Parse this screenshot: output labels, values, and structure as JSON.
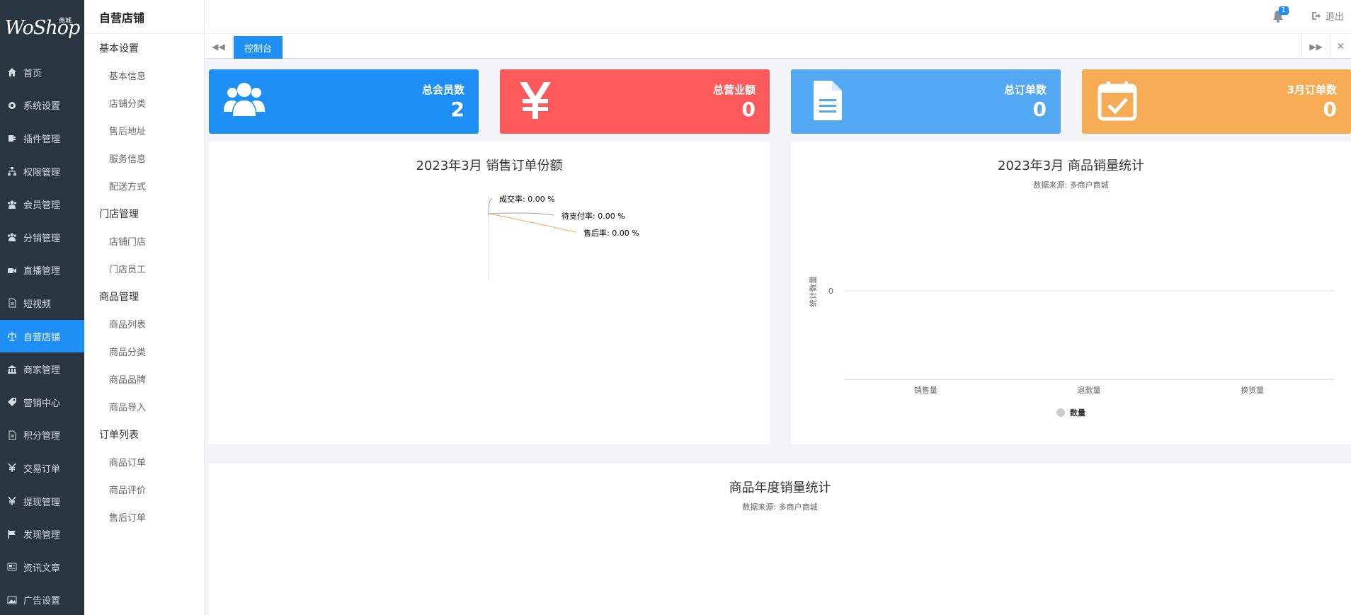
{
  "brand": {
    "logo_text": "WoShop",
    "logo_small": "商城"
  },
  "nav": {
    "items": [
      {
        "label": "首页",
        "icon": "home-icon"
      },
      {
        "label": "系统设置",
        "icon": "gear-icon"
      },
      {
        "label": "插件管理",
        "icon": "plugin-icon"
      },
      {
        "label": "权限管理",
        "icon": "sitemap-icon"
      },
      {
        "label": "会员管理",
        "icon": "users-icon"
      },
      {
        "label": "分销管理",
        "icon": "users-icon"
      },
      {
        "label": "直播管理",
        "icon": "video-icon"
      },
      {
        "label": "短视频",
        "icon": "file-icon"
      },
      {
        "label": "自营店铺",
        "icon": "scale-icon",
        "active": true
      },
      {
        "label": "商家管理",
        "icon": "bank-icon"
      },
      {
        "label": "营销中心",
        "icon": "tag-icon"
      },
      {
        "label": "积分管理",
        "icon": "file-icon"
      },
      {
        "label": "交易订单",
        "icon": "yen-icon"
      },
      {
        "label": "提现管理",
        "icon": "yen-icon"
      },
      {
        "label": "发现管理",
        "icon": "flag-icon"
      },
      {
        "label": "资讯文章",
        "icon": "news-icon"
      },
      {
        "label": "广告设置",
        "icon": "image-icon"
      }
    ],
    "accent": "#1e8ff5",
    "background": "#2a3542"
  },
  "submenu": {
    "title": "自营店铺",
    "groups": [
      {
        "label": "基本设置",
        "links": [
          "基本信息",
          "店铺分类",
          "售后地址",
          "服务信息",
          "配送方式"
        ]
      },
      {
        "label": "门店管理",
        "links": [
          "店铺门店",
          "门店员工"
        ]
      },
      {
        "label": "商品管理",
        "links": [
          "商品列表",
          "商品分类",
          "商品品牌",
          "商品导入"
        ]
      },
      {
        "label": "订单列表",
        "links": [
          "商品订单",
          "商品评价",
          "售后订单"
        ]
      }
    ]
  },
  "topbar": {
    "badge": "1",
    "logout": "退出"
  },
  "tabs": {
    "active": "控制台"
  },
  "cards": [
    {
      "label": "总会员数",
      "value": "2",
      "icon": "users-icon",
      "color": "#1e8ff5"
    },
    {
      "label": "总营业额",
      "value": "0",
      "icon": "yen-icon",
      "color": "#fe5a5b"
    },
    {
      "label": "总订单数",
      "value": "0",
      "icon": "document-icon",
      "color": "#53a8f4"
    },
    {
      "label": "3月订单数",
      "value": "0",
      "icon": "calendar-check-icon",
      "color": "#f6ac55"
    }
  ],
  "panels": {
    "pie_title": "2023年3月 销售订单份额",
    "bar_title": "2023年3月 商品销量统计",
    "bar_source": "数据来源: 多商户商城",
    "year_title": "商品年度销量统计",
    "year_source": "数据来源: 多商户商城"
  },
  "chart_data": [
    {
      "type": "pie",
      "title": "2023年3月 销售订单份额",
      "slices": [
        {
          "label": "成交率",
          "value": 0.0,
          "display": "成交率: 0.00 %"
        },
        {
          "label": "待支付率",
          "value": 0.0,
          "display": "待支付率: 0.00 %"
        },
        {
          "label": "售后率",
          "value": 0.0,
          "display": "售后率: 0.00 %"
        }
      ]
    },
    {
      "type": "bar",
      "title": "2023年3月 商品销量统计",
      "subtitle": "数据来源: 多商户商城",
      "categories": [
        "销售量",
        "退款量",
        "换货量"
      ],
      "series": [
        {
          "name": "数量",
          "values": [
            0,
            0,
            0
          ]
        }
      ],
      "ylabel": "统计数量",
      "yticks": [
        "0"
      ],
      "legend": "bottom"
    }
  ]
}
